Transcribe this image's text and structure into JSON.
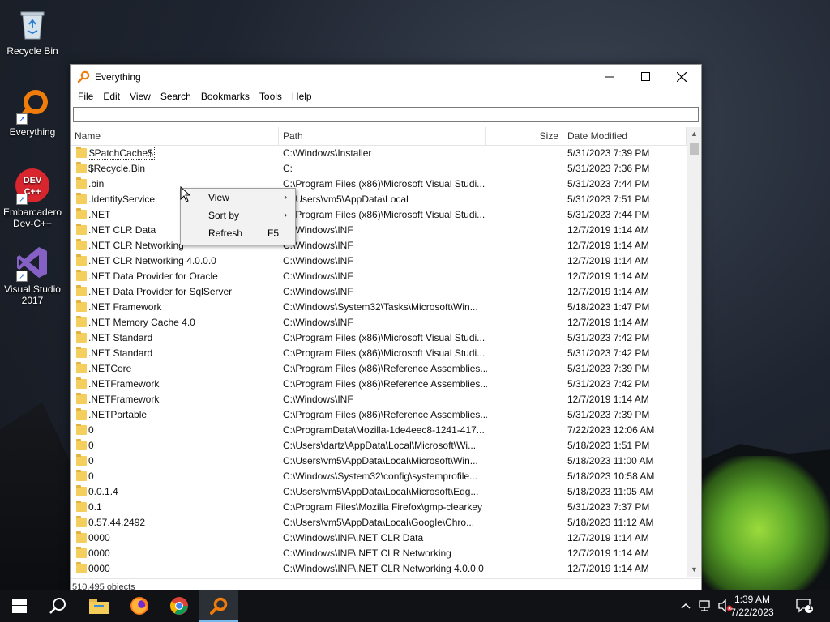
{
  "desktop": {
    "icons": [
      {
        "label": "Recycle Bin"
      },
      {
        "label": "Everything"
      },
      {
        "label": "Embarcadero Dev-C++"
      },
      {
        "label": "Visual Studio 2017"
      }
    ]
  },
  "window": {
    "title": "Everything",
    "menu": [
      "File",
      "Edit",
      "View",
      "Search",
      "Bookmarks",
      "Tools",
      "Help"
    ],
    "search": {
      "value": "",
      "placeholder": ""
    },
    "columns": {
      "name": "Name",
      "path": "Path",
      "size": "Size",
      "date": "Date Modified"
    },
    "rows": [
      {
        "name": "$PatchCache$",
        "path": "C:\\Windows\\Installer",
        "size": "",
        "date": "5/31/2023 7:39 PM"
      },
      {
        "name": "$Recycle.Bin",
        "path": "C:",
        "size": "",
        "date": "5/31/2023 7:36 PM"
      },
      {
        "name": ".bin",
        "path": "C:\\Program Files (x86)\\Microsoft Visual Studi...",
        "size": "",
        "date": "5/31/2023 7:44 PM"
      },
      {
        "name": ".IdentityService",
        "path": "C:\\Users\\vm5\\AppData\\Local",
        "size": "",
        "date": "5/31/2023 7:51 PM"
      },
      {
        "name": ".NET",
        "path": "C:\\Program Files (x86)\\Microsoft Visual Studi...",
        "size": "",
        "date": "5/31/2023 7:44 PM"
      },
      {
        "name": ".NET CLR Data",
        "path": "C:\\Windows\\INF",
        "size": "",
        "date": "12/7/2019 1:14 AM"
      },
      {
        "name": ".NET CLR Networking",
        "path": "C:\\Windows\\INF",
        "size": "",
        "date": "12/7/2019 1:14 AM"
      },
      {
        "name": ".NET CLR Networking 4.0.0.0",
        "path": "C:\\Windows\\INF",
        "size": "",
        "date": "12/7/2019 1:14 AM"
      },
      {
        "name": ".NET Data Provider for Oracle",
        "path": "C:\\Windows\\INF",
        "size": "",
        "date": "12/7/2019 1:14 AM"
      },
      {
        "name": ".NET Data Provider for SqlServer",
        "path": "C:\\Windows\\INF",
        "size": "",
        "date": "12/7/2019 1:14 AM"
      },
      {
        "name": ".NET Framework",
        "path": "C:\\Windows\\System32\\Tasks\\Microsoft\\Win...",
        "size": "",
        "date": "5/18/2023 1:47 PM"
      },
      {
        "name": ".NET Memory Cache 4.0",
        "path": "C:\\Windows\\INF",
        "size": "",
        "date": "12/7/2019 1:14 AM"
      },
      {
        "name": ".NET Standard",
        "path": "C:\\Program Files (x86)\\Microsoft Visual Studi...",
        "size": "",
        "date": "5/31/2023 7:42 PM"
      },
      {
        "name": ".NET Standard",
        "path": "C:\\Program Files (x86)\\Microsoft Visual Studi...",
        "size": "",
        "date": "5/31/2023 7:42 PM"
      },
      {
        "name": ".NETCore",
        "path": "C:\\Program Files (x86)\\Reference Assemblies...",
        "size": "",
        "date": "5/31/2023 7:39 PM"
      },
      {
        "name": ".NETFramework",
        "path": "C:\\Program Files (x86)\\Reference Assemblies...",
        "size": "",
        "date": "5/31/2023 7:42 PM"
      },
      {
        "name": ".NETFramework",
        "path": "C:\\Windows\\INF",
        "size": "",
        "date": "12/7/2019 1:14 AM"
      },
      {
        "name": ".NETPortable",
        "path": "C:\\Program Files (x86)\\Reference Assemblies...",
        "size": "",
        "date": "5/31/2023 7:39 PM"
      },
      {
        "name": "0",
        "path": "C:\\ProgramData\\Mozilla-1de4eec8-1241-417...",
        "size": "",
        "date": "7/22/2023 12:06 AM"
      },
      {
        "name": "0",
        "path": "C:\\Users\\dartz\\AppData\\Local\\Microsoft\\Wi...",
        "size": "",
        "date": "5/18/2023 1:51 PM"
      },
      {
        "name": "0",
        "path": "C:\\Users\\vm5\\AppData\\Local\\Microsoft\\Win...",
        "size": "",
        "date": "5/18/2023 11:00 AM"
      },
      {
        "name": "0",
        "path": "C:\\Windows\\System32\\config\\systemprofile...",
        "size": "",
        "date": "5/18/2023 10:58 AM"
      },
      {
        "name": "0.0.1.4",
        "path": "C:\\Users\\vm5\\AppData\\Local\\Microsoft\\Edg...",
        "size": "",
        "date": "5/18/2023 11:05 AM"
      },
      {
        "name": "0.1",
        "path": "C:\\Program Files\\Mozilla Firefox\\gmp-clearkey",
        "size": "",
        "date": "5/31/2023 7:37 PM"
      },
      {
        "name": "0.57.44.2492",
        "path": "C:\\Users\\vm5\\AppData\\Local\\Google\\Chro...",
        "size": "",
        "date": "5/18/2023 11:12 AM"
      },
      {
        "name": "0000",
        "path": "C:\\Windows\\INF\\.NET CLR Data",
        "size": "",
        "date": "12/7/2019 1:14 AM"
      },
      {
        "name": "0000",
        "path": "C:\\Windows\\INF\\.NET CLR Networking",
        "size": "",
        "date": "12/7/2019 1:14 AM"
      },
      {
        "name": "0000",
        "path": "C:\\Windows\\INF\\.NET CLR Networking 4.0.0.0",
        "size": "",
        "date": "12/7/2019 1:14 AM"
      }
    ],
    "status": "510,495 objects"
  },
  "context_menu": {
    "items": [
      {
        "label": "View",
        "submenu": true,
        "shortcut": ""
      },
      {
        "label": "Sort by",
        "submenu": true,
        "shortcut": ""
      },
      {
        "label": "Refresh",
        "submenu": false,
        "shortcut": "F5"
      }
    ]
  },
  "taskbar": {
    "time": "1:39 AM",
    "date": "7/22/2023",
    "notification_count": "1"
  },
  "colors": {
    "folder": "#f4cf5d",
    "accent": "#76b9ed",
    "taskbar": "#101216"
  }
}
